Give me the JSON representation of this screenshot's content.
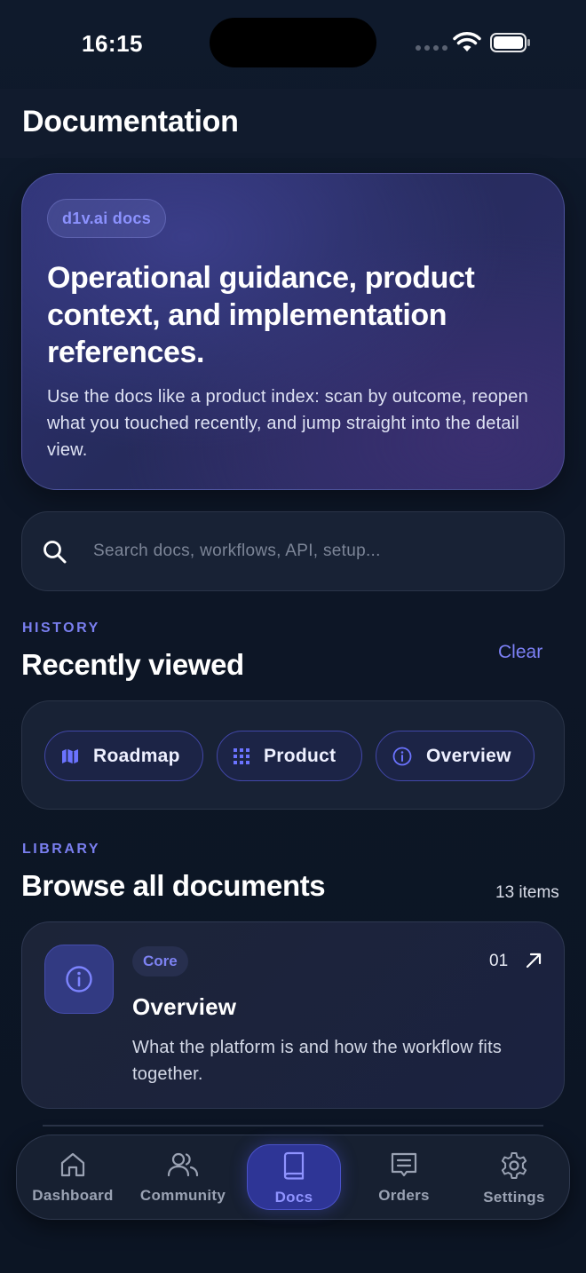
{
  "status_bar": {
    "time": "16:15"
  },
  "header": {
    "title": "Documentation"
  },
  "hero": {
    "badge": "d1v.ai docs",
    "title": "Operational guidance, product context, and implementation references.",
    "description": "Use the docs like a product index: scan by outcome, reopen what you touched recently, and jump straight into the detail view."
  },
  "search": {
    "placeholder": "Search docs, workflows, API, setup...",
    "value": ""
  },
  "history": {
    "eyebrow": "HISTORY",
    "title": "Recently viewed",
    "clear_label": "Clear",
    "items": [
      {
        "label": "Roadmap",
        "icon": "map-icon"
      },
      {
        "label": "Product",
        "icon": "grid-icon"
      },
      {
        "label": "Overview",
        "icon": "info-icon"
      }
    ]
  },
  "library": {
    "eyebrow": "LIBRARY",
    "title": "Browse all documents",
    "count_label": "13 items",
    "documents": [
      {
        "tag": "Core",
        "number": "01",
        "title": "Overview",
        "description": "What the platform is and how the workflow fits together.",
        "icon": "info-icon"
      }
    ]
  },
  "tabbar": {
    "active": "Docs",
    "tabs": [
      {
        "label": "Dashboard",
        "icon": "home-icon"
      },
      {
        "label": "Community",
        "icon": "users-icon"
      },
      {
        "label": "Docs",
        "icon": "book-icon"
      },
      {
        "label": "Orders",
        "icon": "receipt-icon"
      },
      {
        "label": "Settings",
        "icon": "gear-icon"
      }
    ]
  },
  "colors": {
    "accent": "#7c80f5",
    "background": "#0d1626",
    "card": "#182235"
  }
}
